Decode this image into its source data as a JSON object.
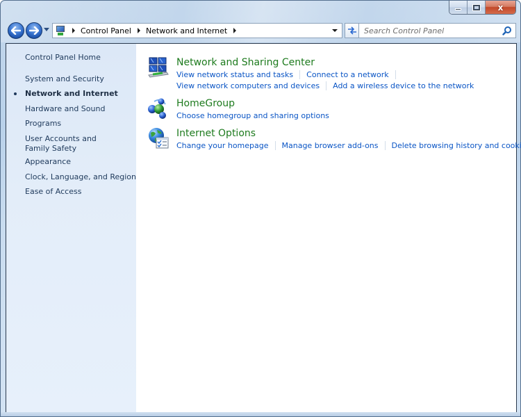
{
  "window": {
    "caption_buttons": {
      "minimize": "minimize",
      "maximize": "maximize",
      "close": "x"
    }
  },
  "nav": {
    "back_glyph": "←",
    "forward_glyph": "→",
    "refresh_glyph": "⇆"
  },
  "address_bar": {
    "breadcrumbs": [
      "Control Panel",
      "Network and Internet"
    ]
  },
  "search": {
    "placeholder": "Search Control Panel",
    "value": ""
  },
  "sidebar": {
    "items": [
      {
        "label": "Control Panel Home",
        "active": false
      },
      {
        "label": "System and Security",
        "active": false
      },
      {
        "label": "Network and Internet",
        "active": true
      },
      {
        "label": "Hardware and Sound",
        "active": false
      },
      {
        "label": "Programs",
        "active": false
      },
      {
        "label": "User Accounts and Family Safety",
        "active": false
      },
      {
        "label": "Appearance",
        "active": false
      },
      {
        "label": "Clock, Language, and Region",
        "active": false
      },
      {
        "label": "Ease of Access",
        "active": false
      }
    ]
  },
  "categories": [
    {
      "title": "Network and Sharing Center",
      "icon": "network-sharing-center-icon",
      "tasks": [
        [
          "View network status and tasks",
          "Connect to a network"
        ],
        [
          "View network computers and devices",
          "Add a wireless device to the network"
        ]
      ]
    },
    {
      "title": "HomeGroup",
      "icon": "homegroup-icon",
      "tasks": [
        [
          "Choose homegroup and sharing options"
        ]
      ]
    },
    {
      "title": "Internet Options",
      "icon": "internet-options-icon",
      "tasks": [
        [
          "Change your homepage",
          "Manage browser add-ons",
          "Delete browsing history and cookies"
        ]
      ]
    }
  ],
  "colors": {
    "category_title": "#1e7b1e",
    "task_link": "#0a55c5",
    "sidebar_text": "#1e395b"
  }
}
